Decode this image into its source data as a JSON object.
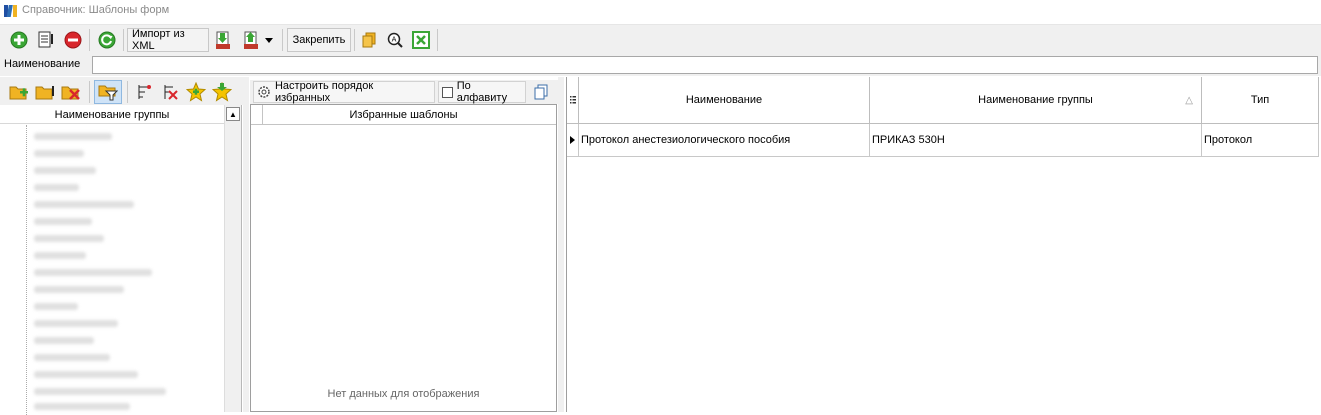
{
  "window": {
    "title": "Справочник: Шаблоны форм"
  },
  "toolbar": {
    "import_xml_label": "Импорт из XML",
    "pin_label": "Закрепить"
  },
  "filter": {
    "label": "Наименование",
    "value": ""
  },
  "tree": {
    "column_header": "Наименование группы"
  },
  "favorites": {
    "configure_order_label": "Настроить порядок избранных",
    "alphabetical_label": "По алфавиту",
    "column_header": "Избранные шаблоны",
    "empty_text": "Нет данных для отображения"
  },
  "grid": {
    "columns": [
      {
        "label": "Наименование"
      },
      {
        "label": "Наименование группы",
        "sort": "△"
      },
      {
        "label": "Тип"
      }
    ],
    "rows": [
      {
        "name": "Протокол анестезиологического пособия",
        "group": "ПРИКАЗ 530Н",
        "type": "Протокол"
      }
    ]
  },
  "colors": {
    "add_green": "#3aa635",
    "delete_red": "#d8262c",
    "folder_yellow": "#f0b323",
    "accent_blue": "#2d6db5"
  }
}
